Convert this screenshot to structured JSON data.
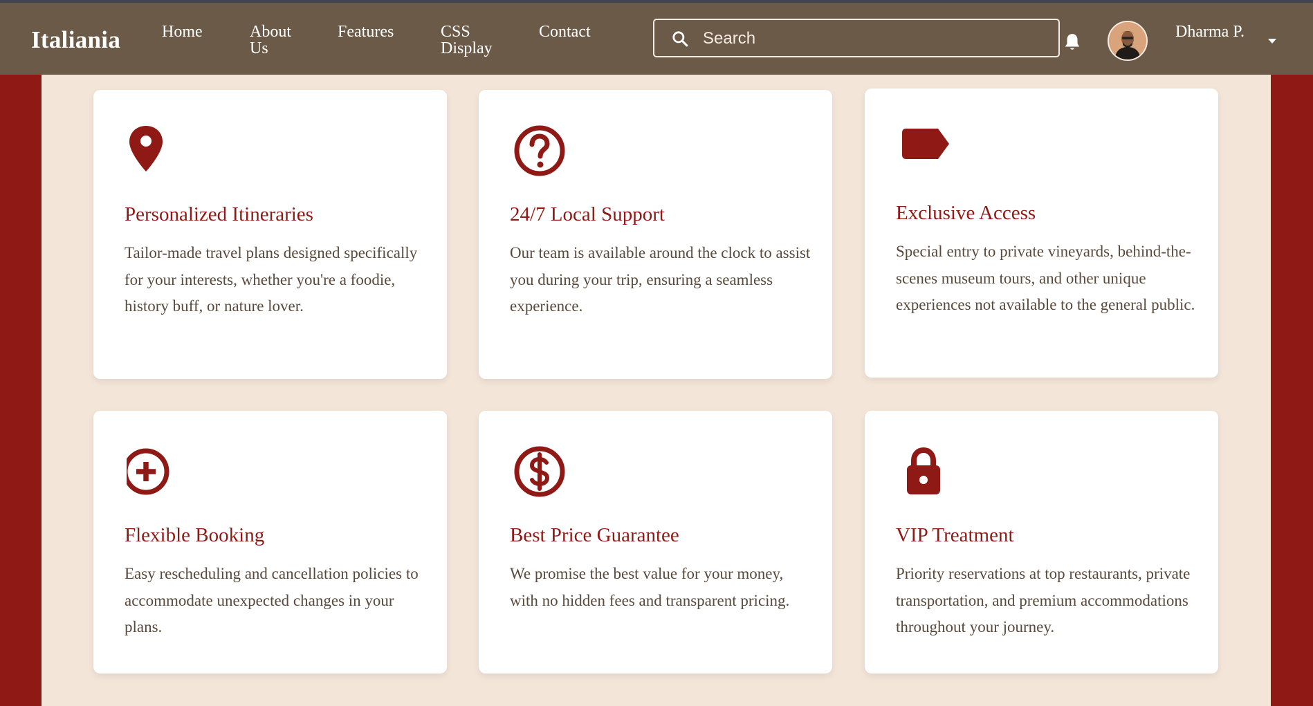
{
  "brand": "Italiania",
  "nav": {
    "home": "Home",
    "about": "About Us",
    "features": "Features",
    "css_display": "CSS Display",
    "contact": "Contact"
  },
  "search": {
    "placeholder": "Search"
  },
  "user": {
    "name": "Dharma P."
  },
  "colors": {
    "navbar": "#6b5a48",
    "accent": "#8f1a15",
    "content_bg": "#f4e5d9",
    "card_bg": "#ffffff"
  },
  "features": [
    {
      "icon": "map-pin-icon",
      "title": "Personalized Itineraries",
      "description": "Tailor-made travel plans designed specifically for your interests, whether you're a foodie, history buff, or nature lover."
    },
    {
      "icon": "question-circle-icon",
      "title": "24/7 Local Support",
      "description": "Our team is available around the clock to assist you during your trip, ensuring a seamless experience."
    },
    {
      "icon": "tag-icon",
      "title": "Exclusive Access",
      "description": "Special entry to private vineyards, behind-the-scenes museum tours, and other unique experiences not available to the general public."
    },
    {
      "icon": "plus-circle-icon",
      "title": "Flexible Booking",
      "description": "Easy rescheduling and cancellation policies to accommodate unexpected changes in your plans."
    },
    {
      "icon": "dollar-circle-icon",
      "title": "Best Price Guarantee",
      "description": "We promise the best value for your money, with no hidden fees and transparent pricing."
    },
    {
      "icon": "lock-icon",
      "title": "VIP Treatment",
      "description": "Priority reservations at top restaurants, private transportation, and premium accommodations throughout your journey."
    }
  ]
}
